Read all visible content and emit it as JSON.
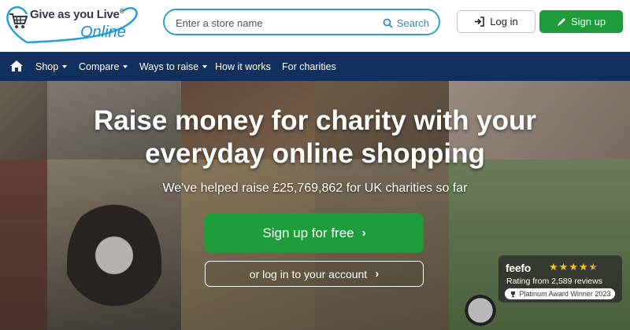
{
  "header": {
    "logo_line1": "Give as you Live",
    "logo_reg": "®",
    "logo_line2": "Online",
    "search_placeholder": "Enter a store name",
    "search_label": "Search",
    "login_label": "Log in",
    "signup_label": "Sign up"
  },
  "nav": {
    "items": [
      {
        "label": "Shop",
        "dropdown": true
      },
      {
        "label": "Compare",
        "dropdown": true
      },
      {
        "label": "Ways to raise",
        "dropdown": true
      },
      {
        "label": "How it works",
        "dropdown": false
      },
      {
        "label": "For charities",
        "dropdown": false
      }
    ]
  },
  "hero": {
    "title_line1": "Raise money for charity with your",
    "title_line2": "everyday online shopping",
    "subtitle": "We've helped raise £25,769,862 for UK charities so far",
    "cta_primary": "Sign up for free",
    "cta_secondary": "or log in to your account"
  },
  "feefo": {
    "logo": "feefo",
    "rating_text": "Rating from 2,589 reviews",
    "award": "Platinum Award Winner 2023",
    "stars": 4.5
  },
  "colors": {
    "brand_blue": "#2a9fd6",
    "nav_navy": "#12305d",
    "cta_green": "#1f9c3a"
  },
  "icons": {
    "logo": "basket-heart-icon",
    "search": "magnifier-icon",
    "login": "sign-in-icon",
    "signup": "pencil-icon",
    "home": "home-icon",
    "award": "trophy-icon"
  }
}
